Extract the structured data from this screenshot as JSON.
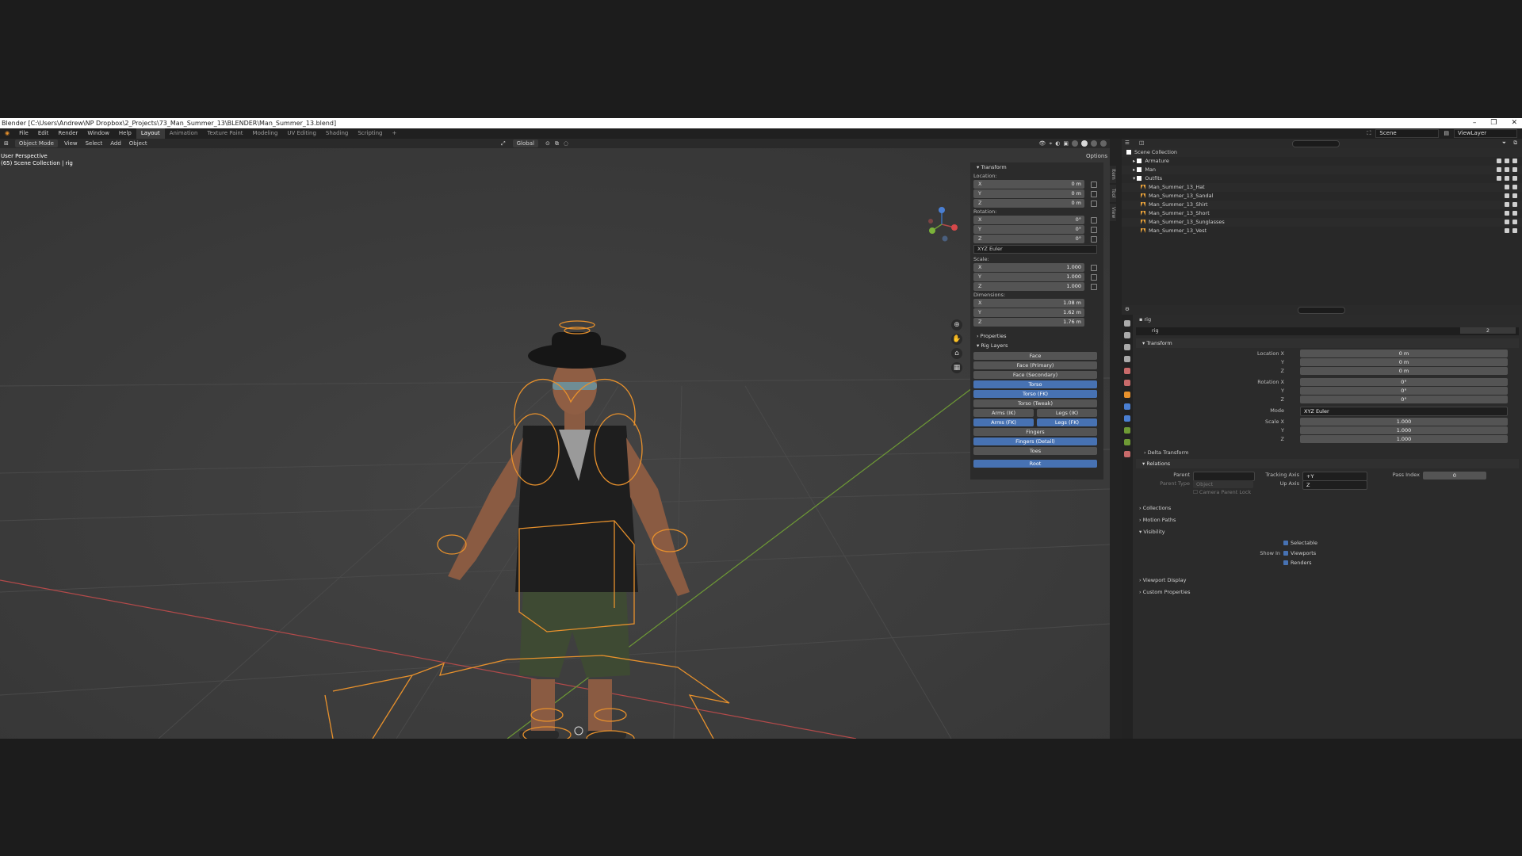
{
  "window": {
    "title": "Blender [C:\\Users\\Andrew\\NP Dropbox\\2_Projects\\73_Man_Summer_13\\BLENDER\\Man_Summer_13.blend]",
    "controls": [
      "–",
      "❐",
      "✕"
    ]
  },
  "menubar": {
    "items": [
      "File",
      "Edit",
      "Render",
      "Window",
      "Help"
    ],
    "workspaces": [
      "Layout",
      "Animation",
      "Texture Paint",
      "Modeling",
      "UV Editing",
      "Shading",
      "Scripting",
      "+"
    ],
    "active_workspace": "Layout",
    "scene": "Scene",
    "view_layer": "ViewLayer"
  },
  "viewport_header": {
    "mode": "Object Mode",
    "menus": [
      "View",
      "Select",
      "Add",
      "Object"
    ],
    "orientation": "Global",
    "options": "Options"
  },
  "viewport": {
    "view_label": "User Perspective",
    "collection_label": "(65) Scene Collection | rig"
  },
  "npanel": {
    "tabs": [
      "Item",
      "Tool",
      "View"
    ],
    "transform_header": "Transform",
    "location_label": "Location:",
    "location": [
      {
        "axis": "X",
        "value": "0 m"
      },
      {
        "axis": "Y",
        "value": "0 m"
      },
      {
        "axis": "Z",
        "value": "0 m"
      }
    ],
    "rotation_label": "Rotation:",
    "rotation": [
      {
        "axis": "X",
        "value": "0°"
      },
      {
        "axis": "Y",
        "value": "0°"
      },
      {
        "axis": "Z",
        "value": "0°"
      }
    ],
    "rotation_mode": "XYZ Euler",
    "scale_label": "Scale:",
    "scale": [
      {
        "axis": "X",
        "value": "1.000"
      },
      {
        "axis": "Y",
        "value": "1.000"
      },
      {
        "axis": "Z",
        "value": "1.000"
      }
    ],
    "dimensions_label": "Dimensions:",
    "dimensions": [
      {
        "axis": "X",
        "value": "1.08 m"
      },
      {
        "axis": "Y",
        "value": "1.62 m"
      },
      {
        "axis": "Z",
        "value": "1.76 m"
      }
    ],
    "properties_header": "Properties",
    "rig_layers_header": "Rig Layers",
    "rig_layers": {
      "face": "Face",
      "face_primary": "Face (Primary)",
      "face_secondary": "Face (Secondary)",
      "torso": "Torso",
      "torso_fk": "Torso (FK)",
      "torso_tweak": "Torso (Tweak)",
      "arms_ik": "Arms (IK)",
      "legs_ik": "Legs (IK)",
      "arms_fk": "Arms (FK)",
      "legs_fk": "Legs (FK)",
      "fingers": "Fingers",
      "fingers_detail": "Fingers (Detail)",
      "toes": "Toes",
      "root": "Root"
    }
  },
  "outliner": {
    "root": "Scene Collection",
    "items": [
      {
        "name": "Armature",
        "type": "collection",
        "indent": 1
      },
      {
        "name": "Man",
        "type": "collection",
        "indent": 1
      },
      {
        "name": "Outfits",
        "type": "collection",
        "indent": 1
      },
      {
        "name": "Man_Summer_13_Hat",
        "type": "mesh",
        "indent": 2
      },
      {
        "name": "Man_Summer_13_Sandal",
        "type": "mesh",
        "indent": 2
      },
      {
        "name": "Man_Summer_13_Shirt",
        "type": "mesh",
        "indent": 2
      },
      {
        "name": "Man_Summer_13_Short",
        "type": "mesh",
        "indent": 2
      },
      {
        "name": "Man_Summer_13_Sunglasses",
        "type": "mesh",
        "indent": 2
      },
      {
        "name": "Man_Summer_13_Vest",
        "type": "mesh",
        "indent": 2
      }
    ]
  },
  "properties": {
    "object_name": "rig",
    "object_field": "rig",
    "users": "2",
    "transform_header": "Transform",
    "location": [
      {
        "label": "Location X",
        "value": "0 m"
      },
      {
        "label": "Y",
        "value": "0 m"
      },
      {
        "label": "Z",
        "value": "0 m"
      }
    ],
    "rotation": [
      {
        "label": "Rotation X",
        "value": "0°"
      },
      {
        "label": "Y",
        "value": "0°"
      },
      {
        "label": "Z",
        "value": "0°"
      }
    ],
    "mode_label": "Mode",
    "mode_value": "XYZ Euler",
    "scale": [
      {
        "label": "Scale X",
        "value": "1.000"
      },
      {
        "label": "Y",
        "value": "1.000"
      },
      {
        "label": "Z",
        "value": "1.000"
      }
    ],
    "delta_transform": "Delta Transform",
    "relations_header": "Relations",
    "parent_label": "Parent",
    "parent_type_label": "Parent Type",
    "parent_type_value": "Object",
    "camera_parent_lock": "Camera Parent Lock",
    "tracking_axis_label": "Tracking Axis",
    "tracking_axis_value": "+Y",
    "up_axis_label": "Up Axis",
    "up_axis_value": "Z",
    "pass_index_label": "Pass Index",
    "pass_index_value": "0",
    "collections": "Collections",
    "motion_paths": "Motion Paths",
    "visibility": "Visibility",
    "selectable": "Selectable",
    "show_in_label": "Show In",
    "viewports": "Viewports",
    "renders": "Renders",
    "viewport_display": "Viewport Display",
    "custom_properties": "Custom Properties"
  },
  "colors": {
    "accent_blue": "#4772b3",
    "rig_orange": "#e8912c",
    "x_axis": "#b34a4a",
    "y_axis": "#6e9a35"
  }
}
